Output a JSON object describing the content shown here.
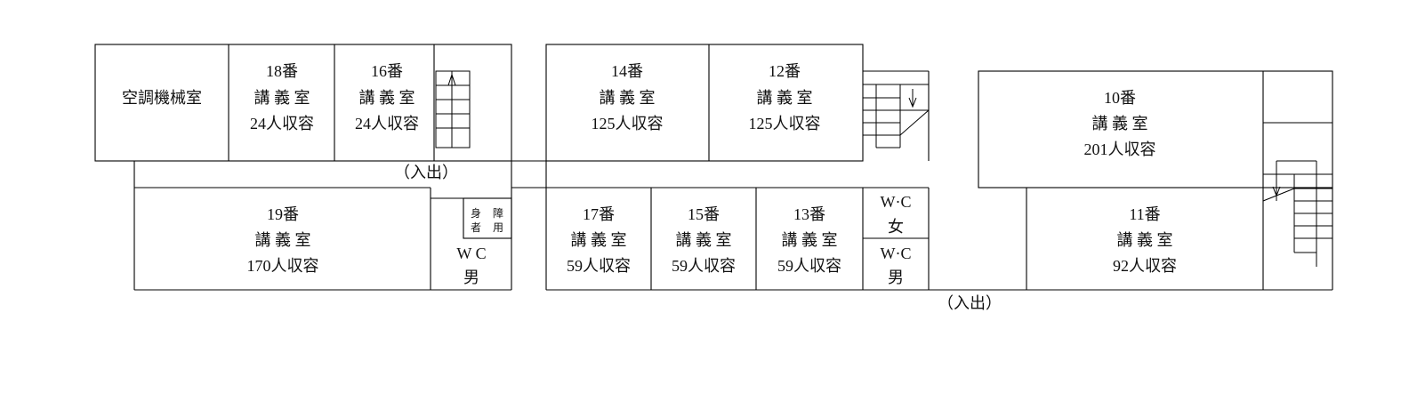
{
  "rooms": {
    "aircon": "空調機械室",
    "r18": [
      "18番",
      "講 義 室",
      "24人収容"
    ],
    "r16": [
      "16番",
      "講 義 室",
      "24人収容"
    ],
    "r14": [
      "14番",
      "講 義 室",
      "125人収容"
    ],
    "r12": [
      "12番",
      "講 義 室",
      "125人収容"
    ],
    "r10": [
      "10番",
      "講 義 室",
      "201人収容"
    ],
    "r19": [
      "19番",
      "講 義 室",
      "170人収容"
    ],
    "r17": [
      "17番",
      "講 義 室",
      "59人収容"
    ],
    "r15": [
      "15番",
      "講 義 室",
      "59人収容"
    ],
    "r13": [
      "13番",
      "講 義 室",
      "59人収容"
    ],
    "r11": [
      "11番",
      "講 義 室",
      "92人収容"
    ]
  },
  "toilets": {
    "accessible": [
      "身",
      "障",
      "者",
      "用"
    ],
    "wc_west": [
      "W C",
      "男"
    ],
    "wc_female": [
      "W·C",
      "女"
    ],
    "wc_male": [
      "W·C",
      "男"
    ]
  },
  "entrances": {
    "west": "（入出）",
    "east": "（入出）"
  }
}
